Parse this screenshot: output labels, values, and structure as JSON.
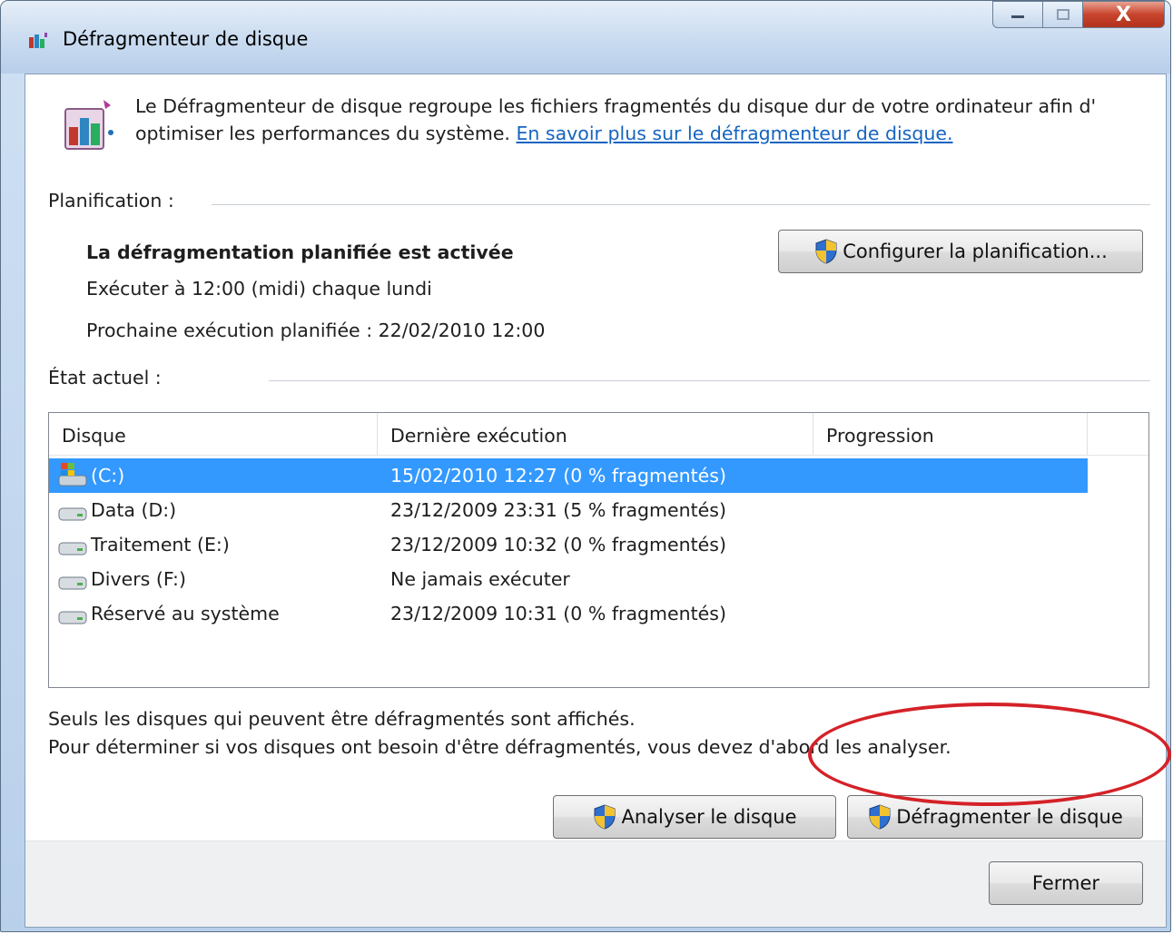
{
  "window": {
    "title": "Défragmenteur de disque",
    "controls": {
      "close_glyph": "X"
    }
  },
  "intro": {
    "text": "Le Défragmenteur de disque regroupe les fichiers fragmentés du disque dur de votre ordinateur afin d' optimiser les performances du système. ",
    "link": "En savoir plus sur le défragmenteur de disque."
  },
  "schedule": {
    "label": "Planification :",
    "status": "La défragmentation planifiée est activée",
    "run_at": "Exécuter à 12:00 (midi) chaque lundi",
    "next_run": "Prochaine exécution planifiée : 22/02/2010 12:00",
    "configure_button": "Configurer la planification..."
  },
  "current_state": {
    "label": "État actuel :",
    "columns": [
      "Disque",
      "Dernière exécution",
      "Progression"
    ],
    "rows": [
      {
        "disk": "(C:)",
        "last_run": "15/02/2010 12:27 (0 % fragmentés)",
        "progress": "",
        "selected": true,
        "icon": "windows-drive-icon"
      },
      {
        "disk": "Data (D:)",
        "last_run": "23/12/2009 23:31 (5 % fragmentés)",
        "progress": "",
        "selected": false,
        "icon": "hard-drive-icon"
      },
      {
        "disk": "Traitement (E:)",
        "last_run": "23/12/2009 10:32 (0 % fragmentés)",
        "progress": "",
        "selected": false,
        "icon": "hard-drive-icon"
      },
      {
        "disk": "Divers (F:)",
        "last_run": "Ne jamais exécuter",
        "progress": "",
        "selected": false,
        "icon": "hard-drive-icon"
      },
      {
        "disk": "Réservé au système",
        "last_run": "23/12/2009 10:31 (0 % fragmentés)",
        "progress": "",
        "selected": false,
        "icon": "hard-drive-icon"
      }
    ]
  },
  "notes": {
    "line1": "Seuls les disques qui peuvent être défragmentés sont affichés.",
    "line2": "Pour déterminer si vos disques ont besoin d'être défragmentés, vous devez d'abord les analyser."
  },
  "actions": {
    "analyze_button": "Analyser le disque",
    "defrag_button": "Défragmenter le disque",
    "close_button": "Fermer"
  },
  "colors": {
    "selection": "#3399ff",
    "link": "#1564c0",
    "highlight_annotation": "#d42228"
  },
  "icons": {
    "title": "defragmenter-icon",
    "uac": "uac-shield-icon"
  }
}
